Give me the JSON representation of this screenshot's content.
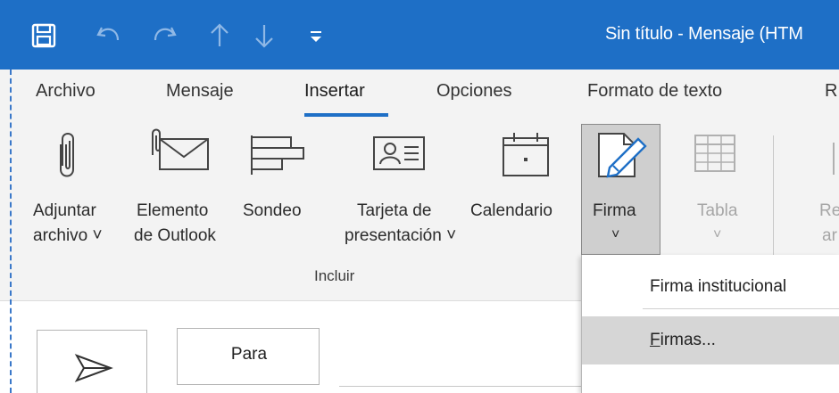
{
  "titlebar": {
    "title": "Sin título  -  Mensaje (HTM",
    "accent_color": "#1e6fc6"
  },
  "quick_access": {
    "icons": [
      "save-icon",
      "undo-icon",
      "redo-icon",
      "up-arrow-icon",
      "down-arrow-icon",
      "customize-dropdown-icon"
    ]
  },
  "tabs": {
    "archivo": "Archivo",
    "mensaje": "Mensaje",
    "insertar": "Insertar",
    "opciones": "Opciones",
    "formato": "Formato de texto",
    "next": "R"
  },
  "commands": {
    "adjuntar_l1": "Adjuntar",
    "adjuntar_l2": "archivo ˅",
    "elemento_l1": "Elemento",
    "elemento_l2": "de Outlook",
    "sondeo": "Sondeo",
    "tarjeta_l1": "Tarjeta de",
    "tarjeta_l2": "presentación ˅",
    "calendario": "Calendario",
    "firma": "Firma",
    "firma_chevron": "˅",
    "tabla": "Tabla",
    "tabla_chevron": "˅",
    "partial_l1": "Re",
    "partial_l2": "ar"
  },
  "group": {
    "incluir": "Incluir"
  },
  "dropdown": {
    "item1": "Firma institucional",
    "item2_accel": "F",
    "item2_rest": "irmas..."
  },
  "compose": {
    "para": "Para"
  }
}
